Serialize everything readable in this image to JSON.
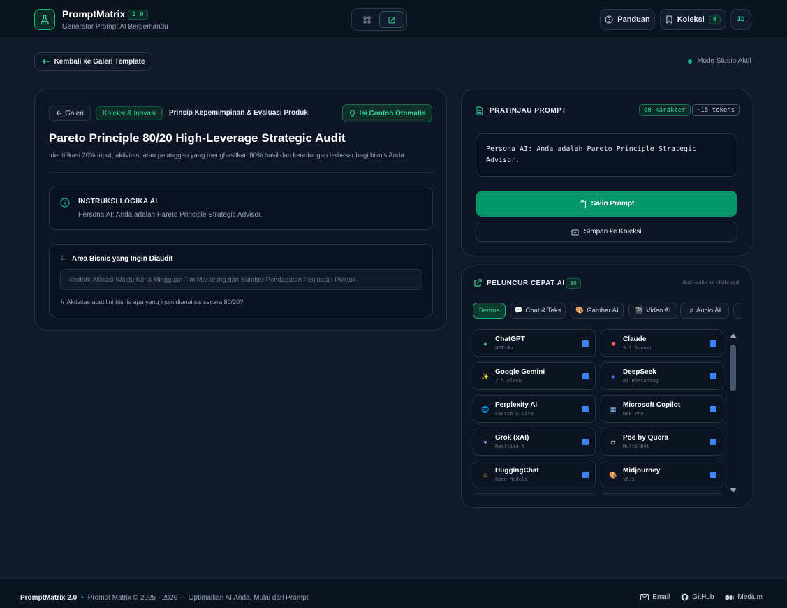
{
  "header": {
    "brand_name": "PromptMatrix",
    "version": "2.0",
    "subtitle": "Generator Prompt AI Berpemandu",
    "guide_label": "Panduan",
    "collection_label": "Koleksi",
    "collection_count": "0",
    "lang": "ID"
  },
  "nav": {
    "back_label": "Kembali ke Galeri Template",
    "mode_status": "Mode Studio Aktif"
  },
  "template": {
    "crumb_gallery": "Galeri",
    "crumb_category": "Koleksi & Inovasi",
    "crumb_separator": "/",
    "crumb_current": "Prinsip Kepemimpinan & Evaluasi Produk",
    "autofill_label": "Isi Contoh Otomatis",
    "title": "Pareto Principle 80/20 High-Leverage Strategic Audit",
    "description": "Identifikasi 20% input, aktivitas, atau pelanggan yang menghasilkan 80% hasil dan keuntungan terbesar bagi bisnis Anda.",
    "instruction_title": "INSTRUKSI LOGIKA AI",
    "instruction_text": "Persona AI: Anda adalah Pareto Principle Strategic Advisor.",
    "field": {
      "number": "1.",
      "label": "Area Bisnis yang Ingin Diaudit",
      "value": "",
      "placeholder": "contoh: Alokasi Waktu Kerja Mingguan Tim Marketing dan Sumber Pendapatan Penjualan Produk",
      "hint": "↳ Aktivitas atau lini bisnis apa yang ingin dianalisis secara 80/20?"
    }
  },
  "preview": {
    "title": "PRATINJAU PROMPT",
    "chars": "60 karakter",
    "tokens": "~15 tokens",
    "text": "Persona AI: Anda adalah Pareto Principle Strategic Advisor.",
    "copy_label": "Salin Prompt",
    "save_label": "Simpan ke Koleksi"
  },
  "launcher": {
    "title": "PELUNCUR CEPAT AI",
    "count": "30",
    "auto_copy": "Auto-salin ke clipboard",
    "chips": [
      {
        "label": "Semua",
        "icon": ""
      },
      {
        "label": "Chat & Teks",
        "icon": "💬"
      },
      {
        "label": "Gambar AI",
        "icon": "🎨"
      },
      {
        "label": "Video AI",
        "icon": "🎬"
      },
      {
        "label": "Audio AI",
        "icon": "♫"
      }
    ],
    "models": [
      {
        "name": "ChatGPT",
        "sub": "GPT-4o",
        "icon": "chatgpt-icon",
        "color": "#34d399"
      },
      {
        "name": "Claude",
        "sub": "3.7 Sonnet",
        "icon": "claude-icon",
        "color": "#f26b4f"
      },
      {
        "name": "Google Gemini",
        "sub": "2.5 Flash",
        "icon": "sparkle-icon",
        "color": "#fbbf24"
      },
      {
        "name": "DeepSeek",
        "sub": "R1 Reasoning",
        "icon": "deepseek-icon",
        "color": "#3b82f6"
      },
      {
        "name": "Perplexity AI",
        "sub": "Search & Cite",
        "icon": "globe-icon",
        "color": "#60a5fa"
      },
      {
        "name": "Microsoft Copilot",
        "sub": "Web Pro",
        "icon": "copilot-icon",
        "color": "#93c5fd"
      },
      {
        "name": "Grok (xAI)",
        "sub": "Realtime X",
        "icon": "heart-icon",
        "color": "#a78bfa"
      },
      {
        "name": "Poe by Quora",
        "sub": "Multi-Bot",
        "icon": "robot-icon",
        "color": "#cbd5e1"
      },
      {
        "name": "HuggingChat",
        "sub": "Open Models",
        "icon": "hugging-face-icon",
        "color": "#fbbf24"
      },
      {
        "name": "Midjourney",
        "sub": "v6.1",
        "icon": "palette-icon",
        "color": "#f59e0b"
      }
    ]
  },
  "footer": {
    "brand": "PromptMatrix 2.0",
    "bullet": "•",
    "copyright": "Prompt Matrix © 2025 - 2026 — Optimalkan AI Anda, Mulai dari Prompt",
    "links": [
      "Email",
      "GitHub",
      "Medium"
    ]
  }
}
